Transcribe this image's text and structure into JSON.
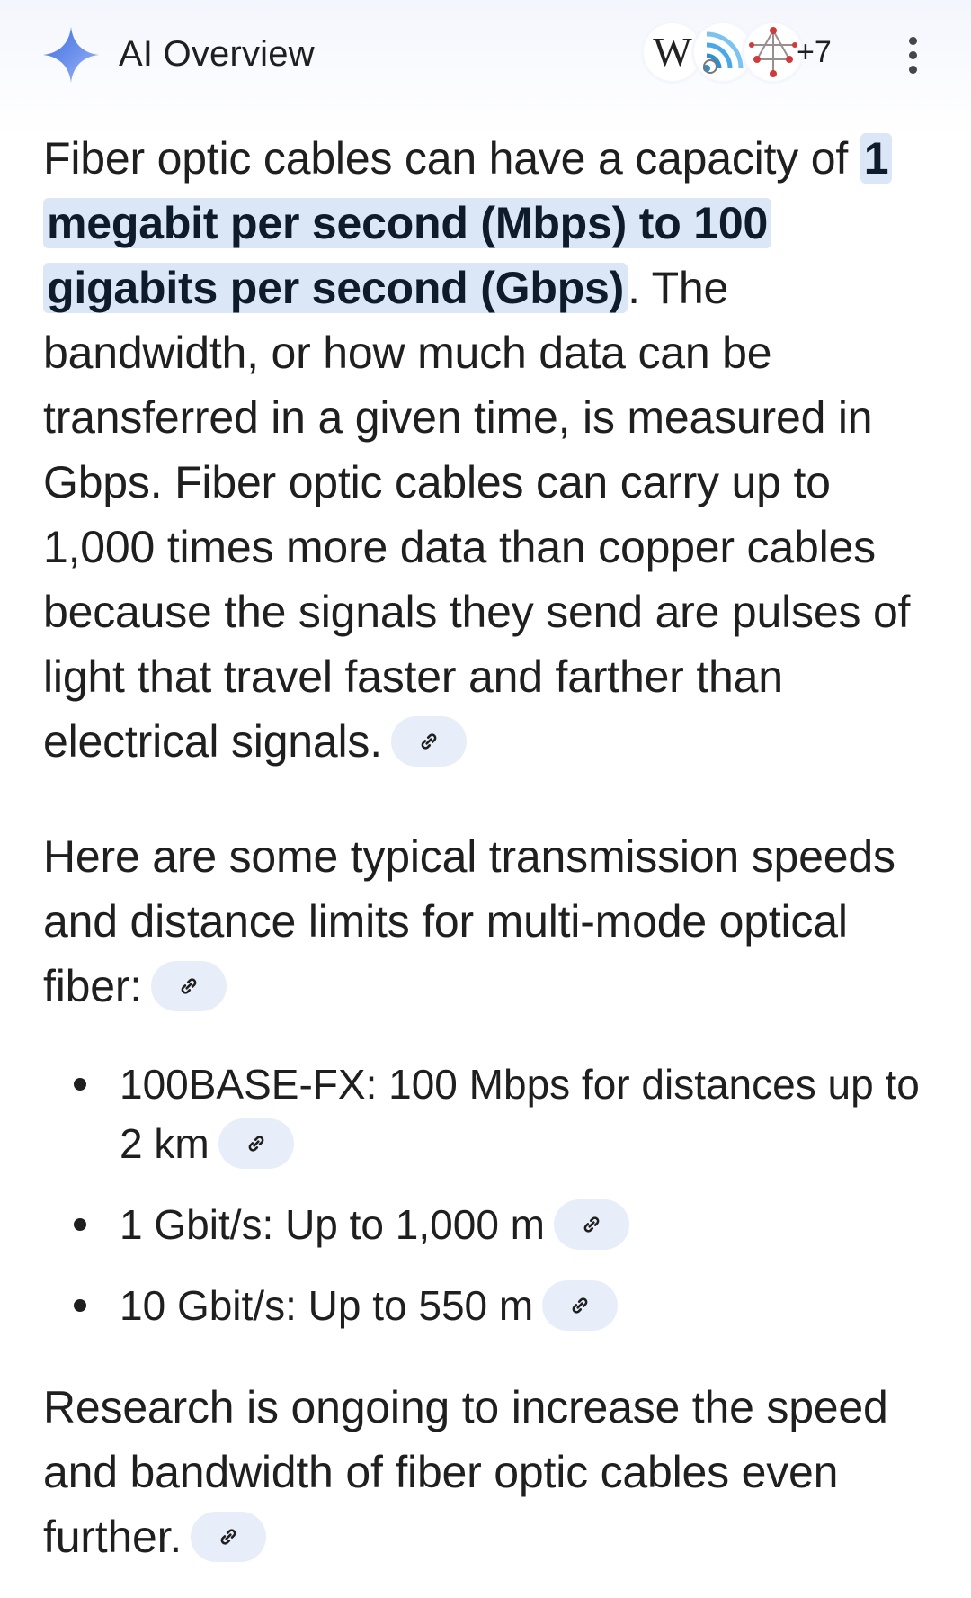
{
  "header": {
    "title": "AI Overview",
    "sources_more": "+7",
    "source_icons": [
      "wikipedia-icon",
      "wifi-signal-icon",
      "network-diagram-icon"
    ]
  },
  "colors": {
    "highlight_bg": "#dbe6f7",
    "chip_bg": "#e8eef9",
    "sparkle_blue": "#4b7bec",
    "text": "#1f1f1f"
  },
  "paragraphs": {
    "p1": {
      "before": "Fiber optic cables can have a capacity of ",
      "highlight": "1 megabit per second (Mbps) to 100 gigabits per second (Gbps)",
      "after": ". The bandwidth, or how much data can be transferred in a given time, is measured in Gbps. Fiber optic cables can carry up to 1,000 times more data than copper cables because the signals they send are pulses of light that travel faster and farther than electrical signals."
    },
    "p2": {
      "text": "Here are some typical transmission speeds and distance limits for multi-mode optical fiber:"
    },
    "p3": {
      "text": "Research is ongoing to increase the speed and bandwidth of fiber optic cables even further."
    }
  },
  "bullets": [
    {
      "text": "100BASE-FX: 100 Mbps for distances up to 2 km"
    },
    {
      "text": "1 Gbit/s: Up to 1,000 m"
    },
    {
      "text": "10 Gbit/s: Up to 550 m"
    }
  ]
}
